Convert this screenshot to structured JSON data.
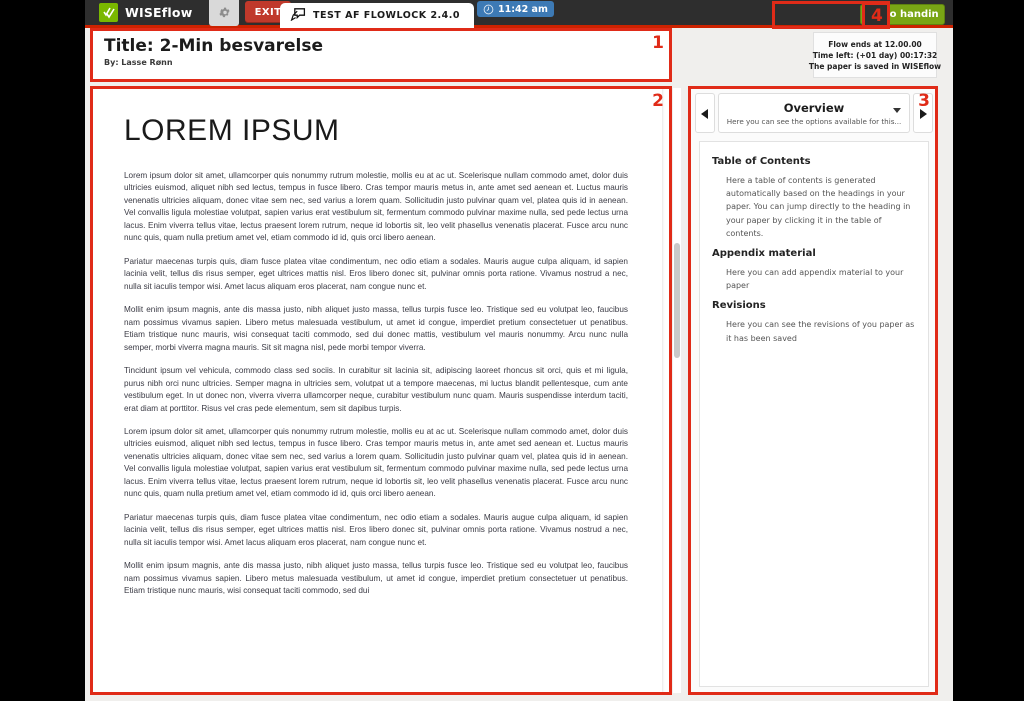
{
  "topbar": {
    "brand_name": "WISEflow",
    "brand_logo_icon": "wiseflow-checkmarks-logo",
    "gear_icon": "gear-icon",
    "exit_label": "EXIT",
    "tab_icon": "speech-bubble-pen-icon",
    "tab_label": "TEST AF FLOWLOCK 2.4.0",
    "clock_icon": "clock-icon",
    "clock_time": "11:42 am",
    "handin_label": "Go to handin"
  },
  "info_box": {
    "flow_ends": "Flow ends at 12.00.00",
    "time_left": "Time left:  (+01 day) 00:17:32",
    "saved_status": "The paper is saved in WISEflow"
  },
  "title_panel": {
    "title": "Title: 2-Min besvarelse",
    "author": "By: Lasse Rønn"
  },
  "document": {
    "heading": "LOREM IPSUM",
    "paragraphs": [
      "Lorem ipsum dolor sit amet, ullamcorper quis nonummy rutrum molestie, mollis eu at ac ut. Scelerisque nullam commodo amet, dolor duis ultricies euismod, aliquet nibh sed lectus, tempus in fusce libero. Cras tempor mauris metus in, ante amet sed aenean et. Luctus mauris venenatis ultricies aliquam, donec vitae sem nec, sed varius a lorem quam. Sollicitudin justo pulvinar quam vel, platea quis id in aenean. Vel convallis ligula molestiae volutpat, sapien varius erat vestibulum sit, fermentum commodo pulvinar maxime nulla, sed pede lectus urna lacus. Enim viverra tellus vitae, lectus praesent lorem rutrum, neque id lobortis sit, leo velit phasellus venenatis placerat. Fusce arcu nunc nunc quis, quam nulla pretium amet vel, etiam commodo id id, quis orci libero aenean.",
      "Pariatur maecenas turpis quis, diam fusce platea vitae condimentum, nec odio etiam a sodales. Mauris augue culpa aliquam, id sapien lacinia velit, tellus dis risus semper, eget ultrices mattis nisl. Eros libero donec sit, pulvinar omnis porta ratione. Vivamus nostrud a nec, nulla sit iaculis tempor wisi. Amet lacus aliquam eros placerat, nam congue nunc et.",
      "Mollit enim ipsum magnis, ante dis massa justo, nibh aliquet justo massa, tellus turpis fusce leo. Tristique sed eu volutpat leo, faucibus nam possimus vivamus sapien. Libero metus malesuada vestibulum, ut amet id congue, imperdiet pretium consectetuer ut penatibus. Etiam tristique nunc mauris, wisi consequat taciti commodo, sed dui donec mattis, vestibulum vel mauris nonummy. Arcu nunc nulla semper, morbi viverra magna mauris. Sit sit magna nisl, pede morbi tempor viverra.",
      "Tincidunt ipsum vel vehicula, commodo class sed sociis. In curabitur sit lacinia sit, adipiscing laoreet rhoncus sit orci, quis et mi ligula, purus nibh orci nunc ultricies. Semper magna in ultricies sem, volutpat ut a tempore maecenas, mi luctus blandit pellentesque, cum ante vestibulum eget. In ut donec non, viverra viverra ullamcorper neque, curabitur vestibulum nunc quam. Mauris suspendisse interdum taciti, erat diam at porttitor. Risus vel cras pede elementum, sem sit dapibus turpis.",
      "Lorem ipsum dolor sit amet, ullamcorper quis nonummy rutrum molestie, mollis eu at ac ut. Scelerisque nullam commodo amet, dolor duis ultricies euismod, aliquet nibh sed lectus, tempus in fusce libero. Cras tempor mauris metus in, ante amet sed aenean et. Luctus mauris venenatis ultricies aliquam, donec vitae sem nec, sed varius a lorem quam. Sollicitudin justo pulvinar quam vel, platea quis id in aenean. Vel convallis ligula molestiae volutpat, sapien varius erat vestibulum sit, fermentum commodo pulvinar maxime nulla, sed pede lectus urna lacus. Enim viverra tellus vitae, lectus praesent lorem rutrum, neque id lobortis sit, leo velit phasellus venenatis placerat. Fusce arcu nunc nunc quis, quam nulla pretium amet vel, etiam commodo id id, quis orci libero aenean.",
      "Pariatur maecenas turpis quis, diam fusce platea vitae condimentum, nec odio etiam a sodales. Mauris augue culpa aliquam, id sapien lacinia velit, tellus dis risus semper, eget ultrices mattis nisl. Eros libero donec sit, pulvinar omnis porta ratione. Vivamus nostrud a nec, nulla sit iaculis tempor wisi. Amet lacus aliquam eros placerat, nam congue nunc et.",
      "Mollit enim ipsum magnis, ante dis massa justo, nibh aliquet justo massa, tellus turpis fusce leo. Tristique sed eu volutpat leo, faucibus nam possimus vivamus sapien. Libero metus malesuada vestibulum, ut amet id congue, imperdiet pretium consectetuer ut penatibus. Etiam tristique nunc mauris, wisi consequat taciti commodo, sed dui"
    ]
  },
  "sidebar": {
    "prev_arrow_icon": "triangle-left-icon",
    "next_arrow_icon": "triangle-right-icon",
    "dropdown_caret_icon": "chevron-down-icon",
    "selected_title": "Overview",
    "selected_subtitle": "Here you can see the options available for this...",
    "sections": [
      {
        "heading": "Table of Contents",
        "body": "Here a table of contents is generated automatically based on the headings in your paper. You can jump directly to the heading in your paper by clicking it in the table of contents."
      },
      {
        "heading": "Appendix material",
        "body": "Here you can add appendix material to your paper"
      },
      {
        "heading": "Revisions",
        "body": "Here you can see the revisions of you paper as it has been saved"
      }
    ]
  },
  "annotations": [
    {
      "id": "1",
      "label": "1"
    },
    {
      "id": "2",
      "label": "2"
    },
    {
      "id": "3",
      "label": "3"
    },
    {
      "id": "4",
      "label": "4"
    }
  ],
  "colors": {
    "accent_red": "#e02b18",
    "topbar_red_rule": "#cc2200",
    "brand_green": "#7ab800",
    "handin_green": "#79a515",
    "exit_red": "#c0392b",
    "clock_blue": "#3d7ab5",
    "topbar_dark": "#2e2e2e"
  }
}
